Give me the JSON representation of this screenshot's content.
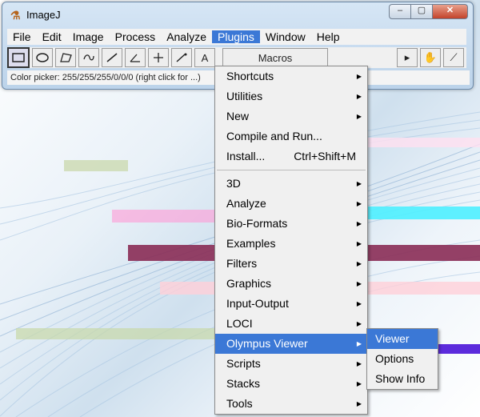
{
  "window": {
    "title": "ImageJ",
    "icon": "microscope-icon",
    "controls": {
      "minimize": "–",
      "maximize": "▢",
      "close": "✕"
    }
  },
  "menubar": {
    "items": [
      "File",
      "Edit",
      "Image",
      "Process",
      "Analyze",
      "Plugins",
      "Window",
      "Help"
    ],
    "active": "Plugins"
  },
  "toolbar": {
    "tools": [
      "rectangle",
      "oval",
      "polygon",
      "freehand",
      "straight-line",
      "angle",
      "point",
      "wand",
      "text"
    ],
    "text_tool_glyph": "A",
    "macros_label": "Macros",
    "right_tools": [
      "▸",
      "✋",
      "⟋"
    ]
  },
  "status": "Color picker: 255/255/255/0/0/0 (right click for ...)",
  "plugins_menu": {
    "items": [
      {
        "label": "Shortcuts",
        "arrow": true
      },
      {
        "label": "Utilities",
        "arrow": true
      },
      {
        "label": "New",
        "arrow": true
      },
      {
        "label": "Compile and Run...",
        "arrow": false
      },
      {
        "label": "Install...",
        "shortcut": "Ctrl+Shift+M"
      },
      {
        "label": "3D",
        "arrow": true
      },
      {
        "label": "Analyze",
        "arrow": true
      },
      {
        "label": "Bio-Formats",
        "arrow": true
      },
      {
        "label": "Examples",
        "arrow": true
      },
      {
        "label": "Filters",
        "arrow": true
      },
      {
        "label": "Graphics",
        "arrow": true
      },
      {
        "label": "Input-Output",
        "arrow": true
      },
      {
        "label": "LOCI",
        "arrow": true
      },
      {
        "label": "Olympus Viewer",
        "arrow": true
      },
      {
        "label": "Scripts",
        "arrow": true
      },
      {
        "label": "Stacks",
        "arrow": true
      },
      {
        "label": "Tools",
        "arrow": true
      }
    ],
    "highlighted": "Olympus Viewer"
  },
  "olympus_submenu": {
    "items": [
      "Viewer",
      "Options",
      "Show Info"
    ],
    "highlighted": "Viewer"
  },
  "colors": {
    "highlight": "#3b78d6",
    "menu_bg": "#f0f0f0",
    "glitch_pink": "#ff9ad6",
    "glitch_cyan": "#4ef0ff",
    "glitch_maroon": "#8a2c55",
    "glitch_purple": "#4a14d8"
  }
}
